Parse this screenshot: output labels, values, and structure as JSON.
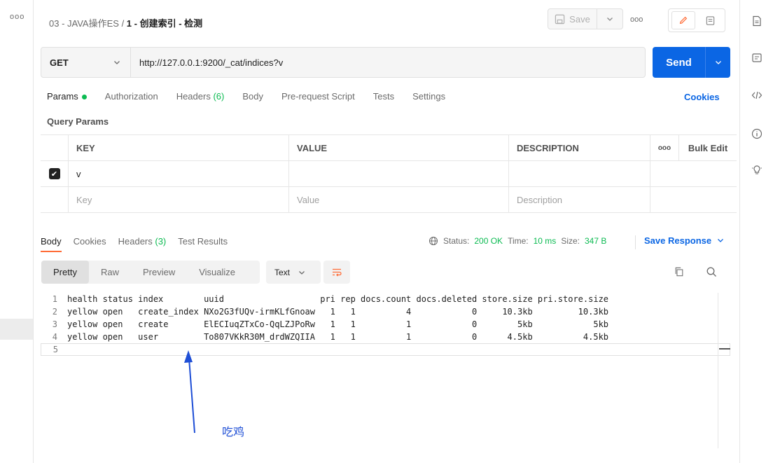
{
  "header": {
    "collection": "03 - JAVA操作ES",
    "separator": " / ",
    "request_name": "1 - 创建索引 - 检测",
    "save_label": "Save",
    "more": "ooo"
  },
  "request": {
    "method": "GET",
    "url": "http://127.0.0.1:9200/_cat/indices?v",
    "send_label": "Send"
  },
  "req_tabs": {
    "params": "Params",
    "authorization": "Authorization",
    "headers": "Headers",
    "headers_count": "(6)",
    "body": "Body",
    "prerequest": "Pre-request Script",
    "tests": "Tests",
    "settings": "Settings",
    "cookies": "Cookies"
  },
  "query_params": {
    "title": "Query Params",
    "col_key": "KEY",
    "col_value": "VALUE",
    "col_description": "DESCRIPTION",
    "more": "ooo",
    "bulk_edit": "Bulk Edit",
    "row1_key": "v",
    "placeholder_key": "Key",
    "placeholder_value": "Value",
    "placeholder_description": "Description"
  },
  "response_tabs": {
    "body": "Body",
    "cookies": "Cookies",
    "headers": "Headers",
    "headers_count": "(3)",
    "test_results": "Test Results"
  },
  "status": {
    "status_label": "Status:",
    "status_value": "200 OK",
    "time_label": "Time:",
    "time_value": "10 ms",
    "size_label": "Size:",
    "size_value": "347 B",
    "save_response": "Save Response"
  },
  "view": {
    "pretty": "Pretty",
    "raw": "Raw",
    "preview": "Preview",
    "visualize": "Visualize",
    "format": "Text"
  },
  "code_lines": [
    {
      "n": "1",
      "text": "health status index        uuid                   pri rep docs.count docs.deleted store.size pri.store.size"
    },
    {
      "n": "2",
      "text": "yellow open   create_index NXo2G3fUQv-irmKLfGnoaw   1   1          4            0     10.3kb         10.3kb"
    },
    {
      "n": "3",
      "text": "yellow open   create       ElECIuqZTxCo-QqLZJPoRw   1   1          1            0        5kb            5kb"
    },
    {
      "n": "4",
      "text": "yellow open   user         To807VKkR30M_drdWZQIIA   1   1          1            0      4.5kb          4.5kb"
    },
    {
      "n": "5",
      "text": ""
    }
  ],
  "annotation": "吃鸡",
  "colors": {
    "accent": "#0b66e4",
    "status_green": "#0cbb52",
    "tab_underline": "#ff6c37",
    "annotation_blue": "#1f4fd6"
  }
}
